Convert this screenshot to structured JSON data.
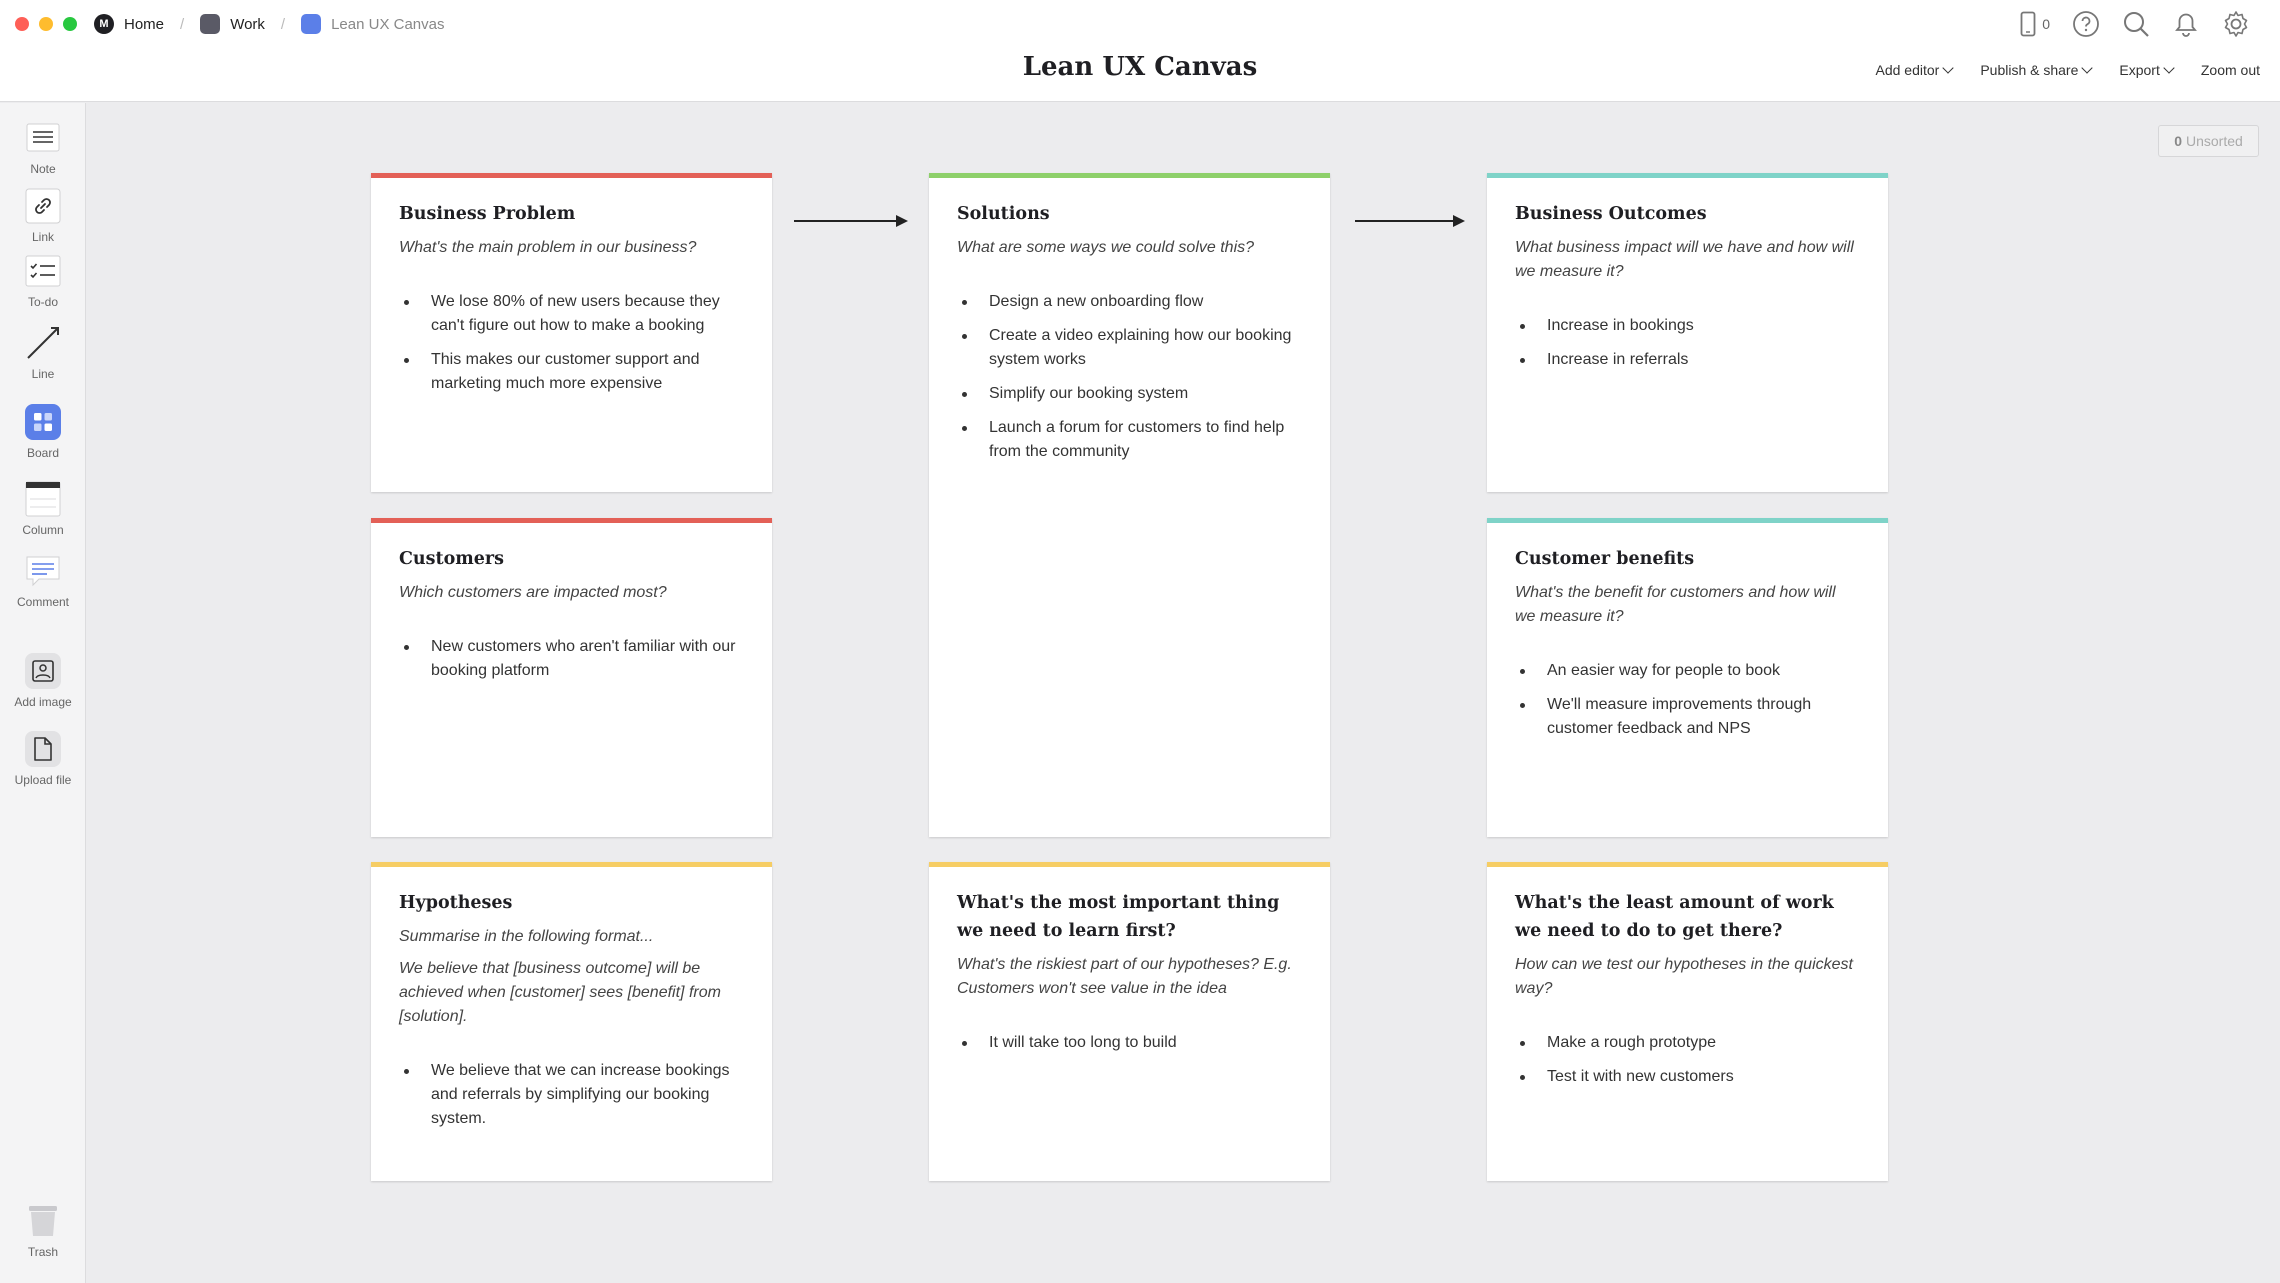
{
  "app": {
    "breadcrumb": [
      {
        "label": "Home",
        "icon": "milanote-logo-icon"
      },
      {
        "label": "Work",
        "icon": "board-icon",
        "color": "#5a5a66"
      },
      {
        "label": "Lean UX Canvas",
        "icon": "board-icon",
        "color": "#5b7fe8"
      }
    ],
    "title": "Lean UX Canvas",
    "device_count": "0",
    "actions": [
      {
        "label": "Add editor",
        "dropdown": true
      },
      {
        "label": "Publish & share",
        "dropdown": true
      },
      {
        "label": "Export",
        "dropdown": true
      },
      {
        "label": "Zoom out",
        "dropdown": false
      }
    ]
  },
  "sidebar": {
    "tools": [
      {
        "label": "Note",
        "icon": "note-icon"
      },
      {
        "label": "Link",
        "icon": "link-icon"
      },
      {
        "label": "To-do",
        "icon": "todo-icon"
      },
      {
        "label": "Line",
        "icon": "line-icon"
      },
      {
        "label": "Board",
        "icon": "board-icon"
      },
      {
        "label": "Column",
        "icon": "column-icon"
      },
      {
        "label": "Comment",
        "icon": "comment-icon"
      },
      {
        "label": "Add image",
        "icon": "image-icon"
      },
      {
        "label": "Upload file",
        "icon": "file-icon"
      },
      {
        "label": "Trash",
        "icon": "trash-icon"
      }
    ]
  },
  "unsorted": {
    "count": "0",
    "label": "Unsorted"
  },
  "colors": {
    "red": "#e36057",
    "green": "#8ed06a",
    "teal": "#7fd3c8",
    "yellow": "#f6cd64",
    "board_blue": "#5b7fe8"
  },
  "cards": {
    "business_problem": {
      "title": "Business Problem",
      "question": "What's the main problem in our business?",
      "items": [
        "We lose 80% of new users because they can't figure out how to make a booking",
        "This makes our customer support and marketing much more expensive"
      ]
    },
    "solutions": {
      "title": "Solutions",
      "question": "What are some ways we could solve this?",
      "items": [
        "Design a new onboarding flow",
        "Create a video explaining how our booking system works",
        "Simplify our booking system",
        "Launch a forum for customers to find help from the community"
      ]
    },
    "business_outcomes": {
      "title": "Business Outcomes",
      "question": "What business impact will we have and how will we measure it?",
      "items": [
        "Increase in bookings",
        "Increase in referrals"
      ]
    },
    "customers": {
      "title": "Customers",
      "question": "Which customers are impacted most?",
      "items": [
        "New customers who aren't familiar with our booking platform"
      ]
    },
    "customer_benefits": {
      "title": "Customer benefits",
      "question": "What's the benefit for customers and how will we measure it?",
      "items": [
        "An easier way for people to book",
        "We'll measure improvements through customer feedback and NPS"
      ]
    },
    "hypotheses": {
      "title": "Hypotheses",
      "question": "Summarise in the following format...",
      "question2": "We believe that [business outcome] will be achieved when [customer] sees [benefit] from [solution].",
      "items": [
        "We believe that we can increase bookings and referrals by simplifying our booking system."
      ]
    },
    "learn_first": {
      "title": "What's the most important thing we need to learn first?",
      "question": "What's the riskiest part of our hypotheses? E.g. Customers won't see value in the idea",
      "items": [
        "It will take too long to build"
      ]
    },
    "least_work": {
      "title": "What's the least amount of work we need to do to get there?",
      "question": "How can we test our hypotheses in the quickest way?",
      "items": [
        "Make a rough prototype",
        "Test it with new customers"
      ]
    }
  }
}
